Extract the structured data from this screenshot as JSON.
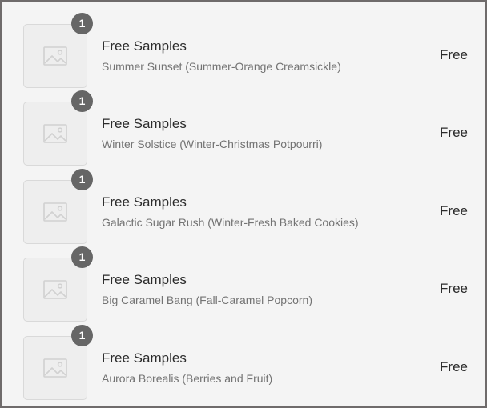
{
  "items": [
    {
      "quantity": "1",
      "title": "Free Samples",
      "variant": "Summer Sunset (Summer-Orange Creamsickle)",
      "price": "Free",
      "thumbnail_icon": "image-placeholder-icon"
    },
    {
      "quantity": "1",
      "title": "Free Samples",
      "variant": "Winter Solstice (Winter-Christmas Potpourri)",
      "price": "Free",
      "thumbnail_icon": "image-placeholder-icon"
    },
    {
      "quantity": "1",
      "title": "Free Samples",
      "variant": "Galactic Sugar Rush (Winter-Fresh Baked Cookies)",
      "price": "Free",
      "thumbnail_icon": "image-placeholder-icon"
    },
    {
      "quantity": "1",
      "title": "Free Samples",
      "variant": "Big Caramel Bang (Fall-Caramel Popcorn)",
      "price": "Free",
      "thumbnail_icon": "image-placeholder-icon"
    },
    {
      "quantity": "1",
      "title": "Free Samples",
      "variant": "Aurora Borealis (Berries and Fruit)",
      "price": "Free",
      "thumbnail_icon": "image-placeholder-icon"
    }
  ],
  "colors": {
    "background": "#f4f4f4",
    "border": "#6f6b6b",
    "badge": "#666666",
    "text_primary": "#2b2b2b",
    "text_secondary": "#737373"
  }
}
